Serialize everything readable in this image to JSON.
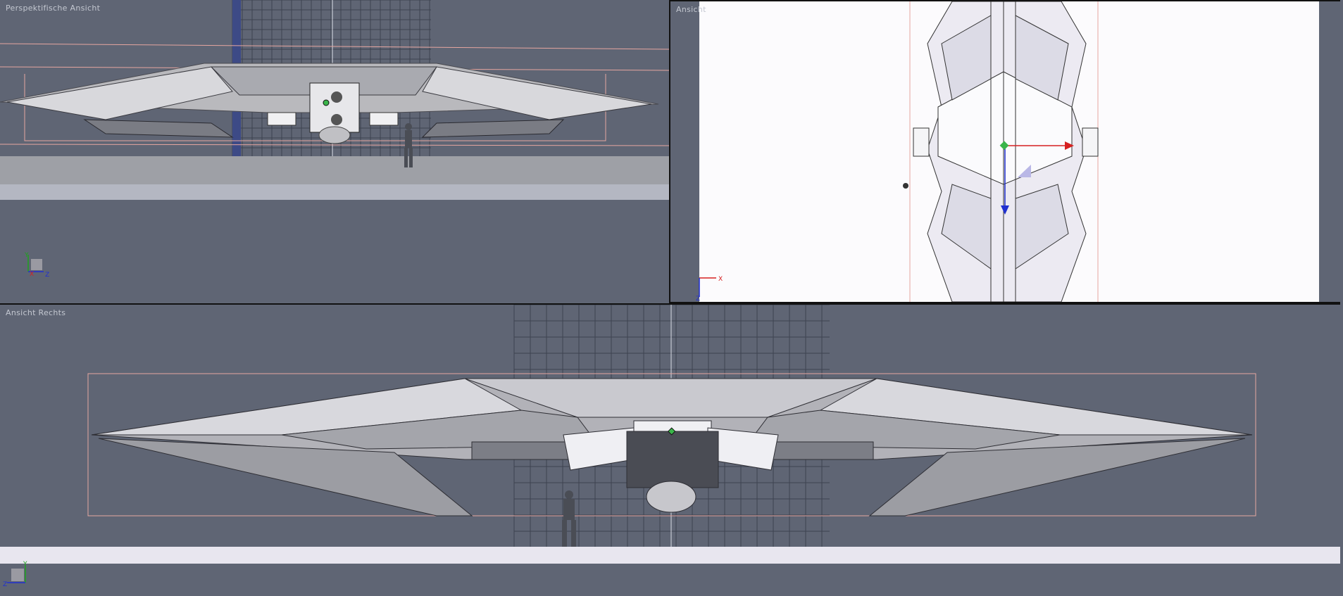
{
  "viewports": {
    "perspective": {
      "label": "Perspektifische Ansicht",
      "axes": {
        "y": "Y",
        "x": "X",
        "z": "Z"
      }
    },
    "top": {
      "label": "Ansicht",
      "axes": {
        "x": "X",
        "z": "Z"
      }
    },
    "right": {
      "label": "Ansicht Rechts",
      "axes": {
        "y": "Y",
        "z": "Z"
      }
    }
  },
  "colors": {
    "viewport_bg": "#5f6574",
    "hull": "#c9c9cd",
    "hull_dark": "#8d8f95",
    "grid": "#3e4250",
    "bbox": "#e6a6a0",
    "axis_x": "#d62020",
    "axis_y": "#1ea31e",
    "axis_z": "#2030d0"
  }
}
